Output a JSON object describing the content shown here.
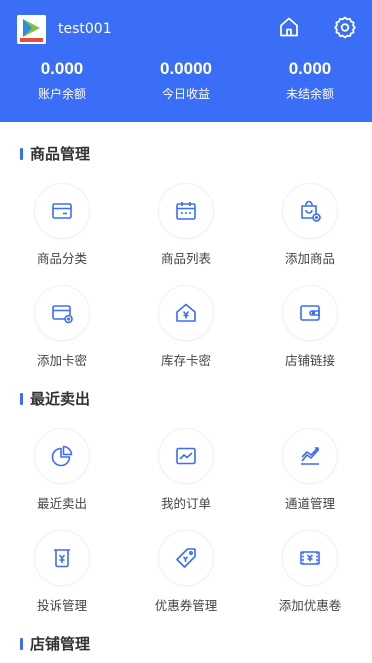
{
  "header": {
    "username": "test001",
    "home_icon": "home-icon",
    "settings_icon": "gear-icon",
    "colors": {
      "bg": "#3a6ef6",
      "text": "#ffffff"
    }
  },
  "stats": [
    {
      "value": "0.000",
      "label": "账户余额"
    },
    {
      "value": "0.0000",
      "label": "今日收益"
    },
    {
      "value": "0.000",
      "label": "未结余额"
    }
  ],
  "sections": {
    "goods": {
      "title": "商品管理",
      "items": [
        {
          "label": "商品分类",
          "icon": "category-icon"
        },
        {
          "label": "商品列表",
          "icon": "list-icon"
        },
        {
          "label": "添加商品",
          "icon": "add-goods-icon"
        },
        {
          "label": "添加卡密",
          "icon": "add-card-icon"
        },
        {
          "label": "库存卡密",
          "icon": "stock-icon"
        },
        {
          "label": "店铺链接",
          "icon": "link-icon"
        }
      ]
    },
    "sales": {
      "title": "最近卖出",
      "items": [
        {
          "label": "最近卖出",
          "icon": "pie-chart-icon"
        },
        {
          "label": "我的订单",
          "icon": "order-chart-icon"
        },
        {
          "label": "通道管理",
          "icon": "channel-icon"
        },
        {
          "label": "投诉管理",
          "icon": "complaint-icon"
        },
        {
          "label": "优惠券管理",
          "icon": "coupon-tag-icon"
        },
        {
          "label": "添加优惠卷",
          "icon": "add-coupon-icon"
        }
      ]
    },
    "shop": {
      "title": "店铺管理"
    }
  },
  "accent_color": "#3a6ef6"
}
